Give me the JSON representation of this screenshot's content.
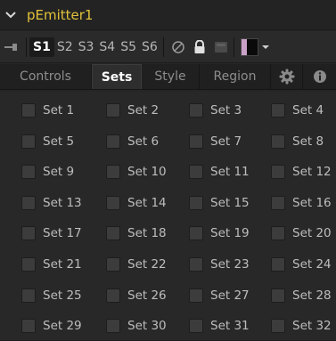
{
  "tool": {
    "name": "pEmitter1",
    "name_color": "#e1c23b"
  },
  "versions": {
    "tabs": [
      "S1",
      "S2",
      "S3",
      "S4",
      "S5",
      "S6"
    ],
    "active": "S1",
    "icons": [
      "pin-icon",
      "disable-icon",
      "lock-icon",
      "cache-icon",
      "color-swatch",
      "dropdown-arrow-icon"
    ]
  },
  "tabs": {
    "controls": "Controls",
    "sets": "Sets",
    "style": "Style",
    "region": "Region",
    "gear_icon": "gear-icon",
    "info_icon": "info-icon",
    "active": "Sets"
  },
  "sets": [
    "Set 1",
    "Set 2",
    "Set 3",
    "Set 4",
    "Set 5",
    "Set 6",
    "Set 7",
    "Set 8",
    "Set 9",
    "Set 10",
    "Set 11",
    "Set 12",
    "Set 13",
    "Set 14",
    "Set 15",
    "Set 16",
    "Set 17",
    "Set 18",
    "Set 19",
    "Set 20",
    "Set 21",
    "Set 22",
    "Set 23",
    "Set 24",
    "Set 25",
    "Set 26",
    "Set 27",
    "Set 28",
    "Set 29",
    "Set 30",
    "Set 31",
    "Set 32"
  ]
}
